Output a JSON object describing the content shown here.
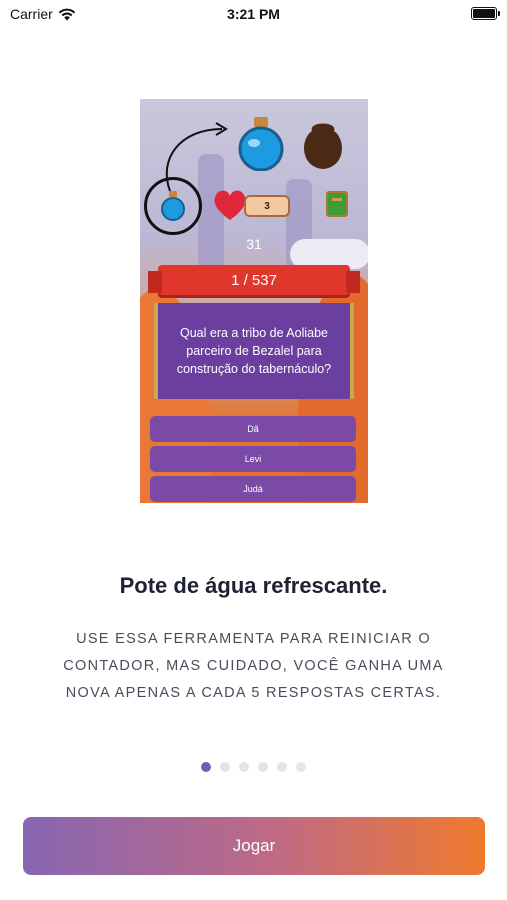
{
  "status_bar": {
    "carrier": "Carrier",
    "time": "3:21 PM"
  },
  "preview": {
    "lives": "3",
    "timer": "31",
    "progress": "1 / 537",
    "question": "Qual era a tribo de Aoliabe parceiro de Bezalel para construção do tabernáculo?",
    "answers": [
      "Dã",
      "Levi",
      "Judá"
    ]
  },
  "tutorial": {
    "title": "Pote de água refrescante.",
    "description": "USE ESSA FERRAMENTA PARA REINICIAR O CONTADOR, MAS CUIDADO, VOCÊ GANHA UMA NOVA APENAS A CADA 5 RESPOSTAS CERTAS.",
    "page_count": 6,
    "current_page": 1
  },
  "play_button_label": "Jogar",
  "colors": {
    "accent_purple": "#7b5bb0",
    "accent_orange": "#ef7a2d",
    "banner_red": "#e0362c"
  }
}
